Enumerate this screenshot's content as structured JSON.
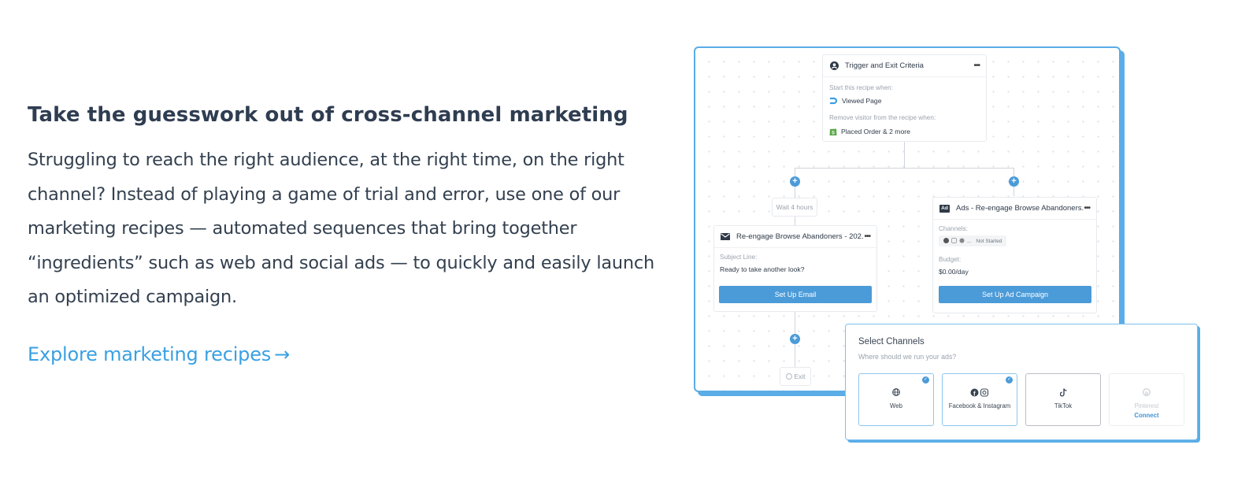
{
  "heading": "Take the guesswork out of cross-channel marketing",
  "body": "Struggling to reach the right audience, at the right time, on the right channel? Instead of playing a game of trial and error, use one of our marketing recipes — automated sequences that bring together “ingredients” such as web and social ads — to quickly and easily launch an optimized campaign.",
  "cta": {
    "label": "Explore marketing recipes",
    "arrow": "→"
  },
  "recipe": {
    "trigger_card": {
      "title": "Trigger and Exit Criteria",
      "menu": "•••",
      "start_label": "Start this recipe when:",
      "start_value": "Viewed Page",
      "remove_label": "Remove visitor from the recipe when:",
      "remove_value": "Placed Order & 2 more"
    },
    "wait_step": "Wait 4 hours",
    "email_card": {
      "title": "Re-engage Browse Abandoners - 202...",
      "menu": "•••",
      "subject_label": "Subject Line:",
      "subject_value": "Ready to take another look?",
      "button": "Set Up Email"
    },
    "ads_card": {
      "badge": "Ad",
      "title": "Ads - Re-engage Browse Abandoners...",
      "menu": "•••",
      "channels_label": "Channels:",
      "channels_status": "Not Started",
      "channels_more": "...",
      "budget_label": "Budget:",
      "budget_value": "$0.00/day",
      "button": "Set Up Ad Campaign"
    },
    "add_step": "+",
    "exit_step": "Exit"
  },
  "select_channels": {
    "title": "Select Channels",
    "subtitle": "Where should we run your ads?",
    "channels": [
      {
        "name": "Web",
        "icon": "globe-icon",
        "selected": true
      },
      {
        "name": "Facebook & Instagram",
        "icon": "facebook-instagram-icon",
        "selected": true
      },
      {
        "name": "TikTok",
        "icon": "tiktok-icon",
        "selected": false
      },
      {
        "name": "Pinterest",
        "icon": "pinterest-icon",
        "selected": false,
        "disabled": true,
        "action": "Connect"
      }
    ]
  },
  "colors": {
    "accent": "#3aa0e2",
    "heading": "#2f3d51",
    "button": "#4b9bd9",
    "frame": "#5aade6"
  }
}
